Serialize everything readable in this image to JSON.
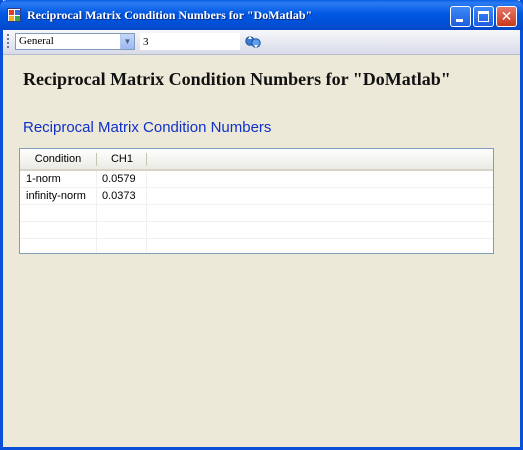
{
  "window": {
    "title": "Reciprocal Matrix Condition Numbers for \"DoMatlab\""
  },
  "toolbar": {
    "category_value": "General",
    "number_value": "3",
    "refresh_icon": "refresh-icon"
  },
  "report": {
    "title": "Reciprocal Matrix Condition Numbers for \"DoMatlab\"",
    "section_title": "Reciprocal Matrix Condition Numbers"
  },
  "table": {
    "columns": [
      "Condition",
      "CH1"
    ],
    "rows": [
      {
        "condition": "1-norm",
        "ch1": "0.0579"
      },
      {
        "condition": "infinity-norm",
        "ch1": "0.0373"
      },
      {
        "condition": "",
        "ch1": ""
      },
      {
        "condition": "",
        "ch1": ""
      },
      {
        "condition": "",
        "ch1": ""
      }
    ]
  },
  "colors": {
    "titlebar": "#0054e3",
    "section_title": "#1030c8",
    "background": "#ece9d8"
  }
}
